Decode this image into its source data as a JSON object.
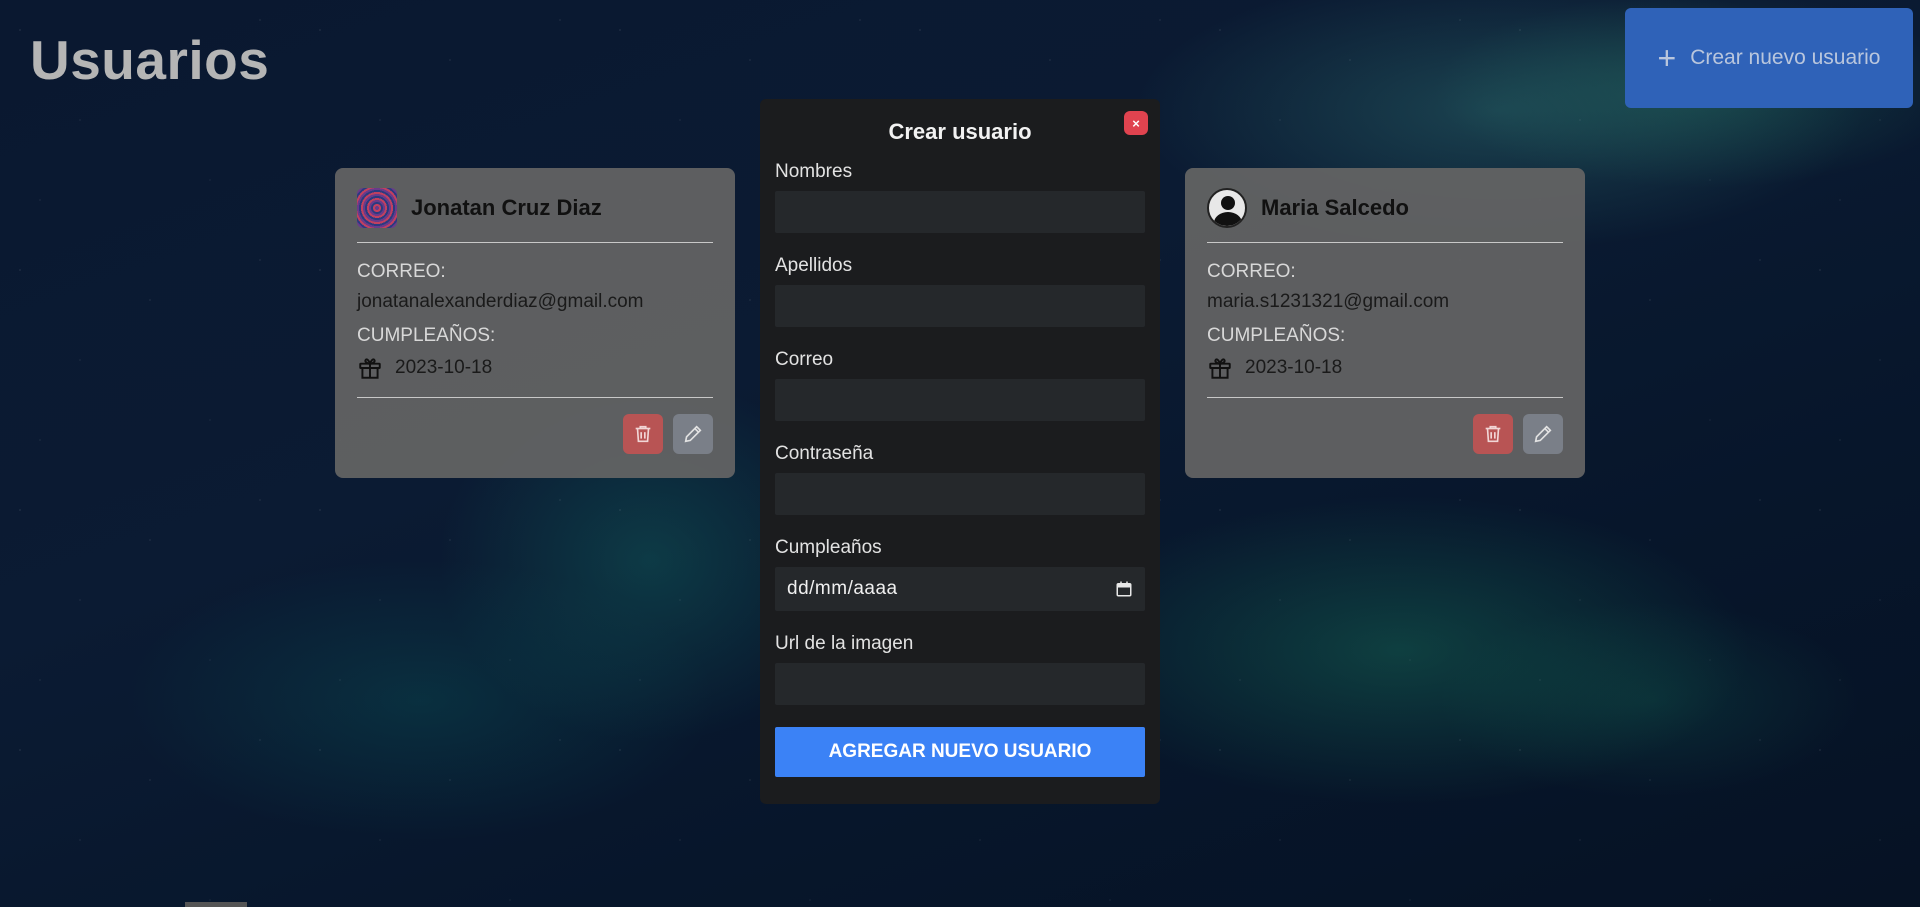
{
  "page": {
    "title": "Usuarios"
  },
  "header": {
    "create_label": "Crear nuevo usuario",
    "create_icon": "plus-icon"
  },
  "users": [
    {
      "name": "Jonatan Cruz Diaz",
      "email_label": "CORREO:",
      "email": "jonatanalexanderdiaz@gmail.com",
      "birthday_label": "CUMPLEAÑOS:",
      "birthday": "2023-10-18"
    },
    {
      "name": "Maria Salcedo",
      "email_label": "CORREO:",
      "email": "maria.s1231321@gmail.com",
      "birthday_label": "CUMPLEAÑOS:",
      "birthday": "2023-10-18"
    }
  ],
  "modal": {
    "title": "Crear usuario",
    "close_symbol": "×",
    "fields": {
      "nombres": "Nombres",
      "apellidos": "Apellidos",
      "correo": "Correo",
      "contrasena": "Contraseña",
      "cumpleanos": "Cumpleaños",
      "url_imagen": "Url de la imagen"
    },
    "date_placeholder": "dd/mm/aaaa",
    "submit_label": "AGREGAR NUEVO USUARIO"
  },
  "colors": {
    "primary": "#3b82f6",
    "create_button": "#2f62b8",
    "delete": "#b85454",
    "close": "#e0434f"
  }
}
